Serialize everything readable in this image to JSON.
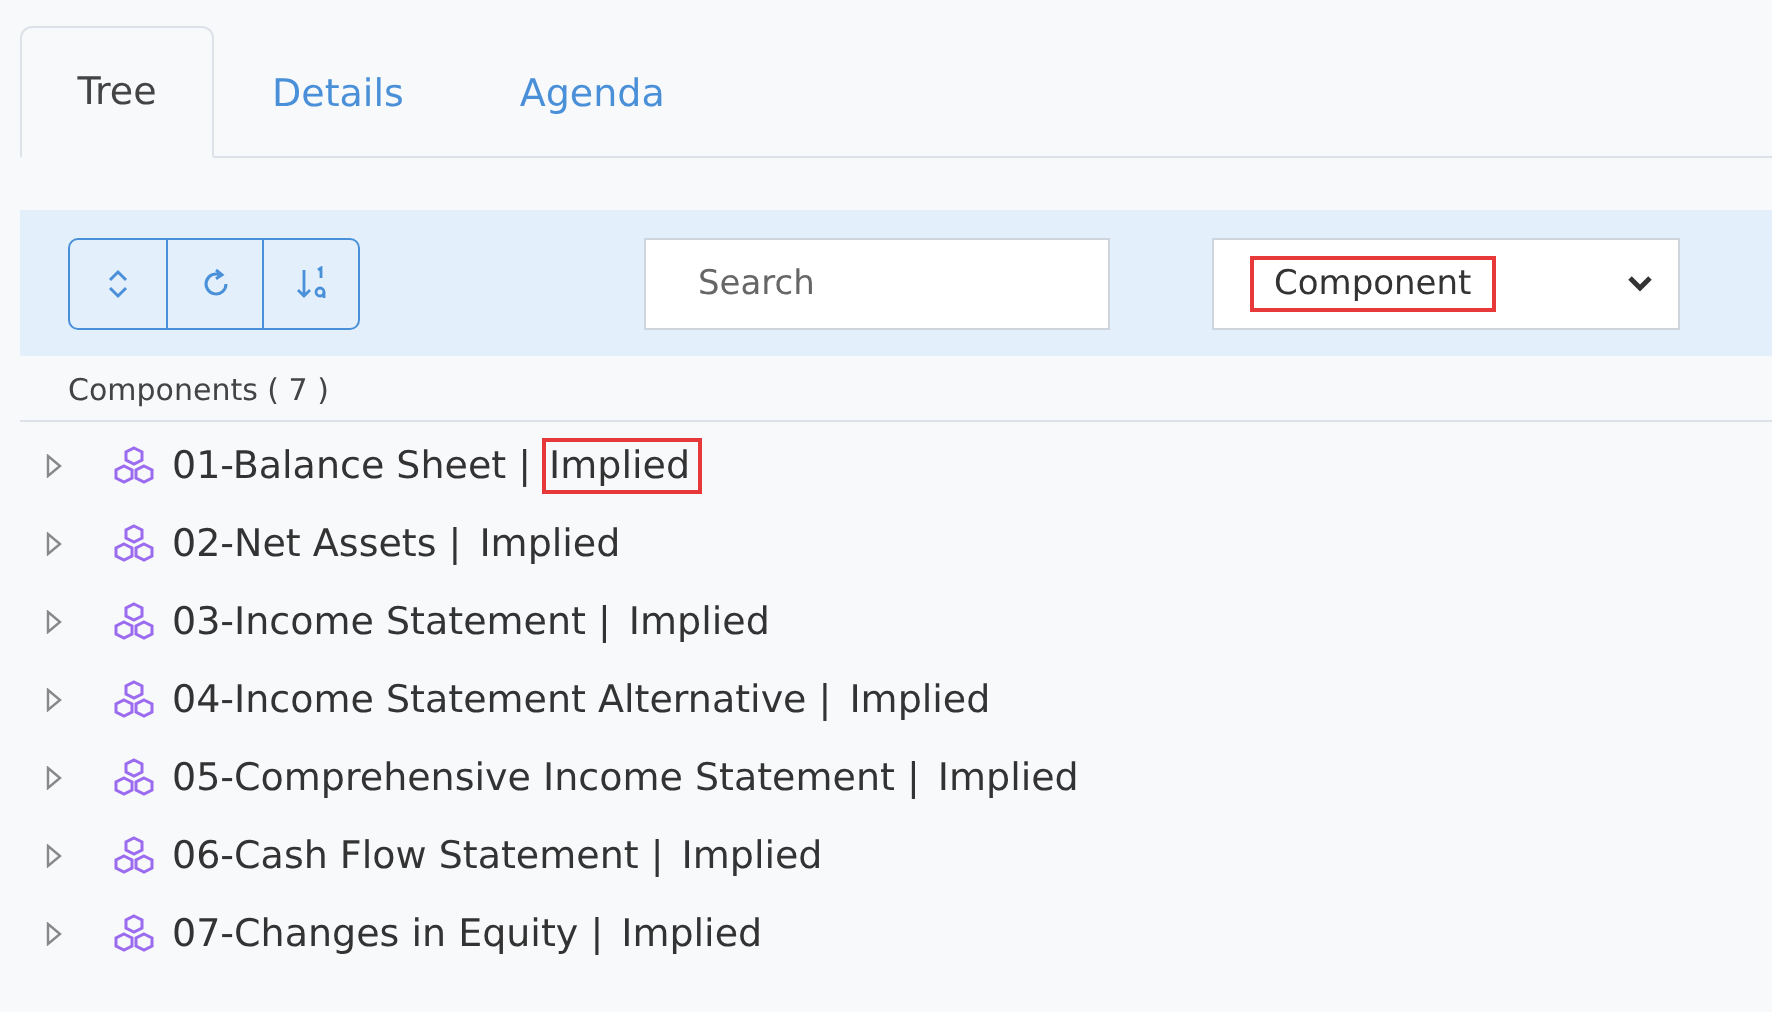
{
  "tabs": [
    {
      "label": "Tree",
      "selected": true
    },
    {
      "label": "Details",
      "selected": false
    },
    {
      "label": "Agenda",
      "selected": false
    }
  ],
  "toolbar": {
    "buttons": [
      {
        "kind": "expand"
      },
      {
        "kind": "refresh"
      },
      {
        "kind": "sort"
      }
    ],
    "search": {
      "placeholder": "Search"
    },
    "type_select": {
      "value": "Component",
      "highlighted": true
    }
  },
  "list_header": "Components ( 7 )",
  "components": [
    {
      "label": "01-Balance Sheet |",
      "status": "Implied",
      "highlighted": true,
      "expanded": false
    },
    {
      "label": "02-Net Assets |",
      "status": "Implied",
      "highlighted": false,
      "expanded": false
    },
    {
      "label": "03-Income Statement |",
      "status": "Implied",
      "highlighted": false,
      "expanded": false
    },
    {
      "label": "04-Income Statement Alternative |",
      "status": "Implied",
      "highlighted": false,
      "expanded": false
    },
    {
      "label": "05-Comprehensive Income Statement |",
      "status": "Implied",
      "highlighted": false,
      "expanded": false
    },
    {
      "label": "06-Cash Flow Statement |",
      "status": "Implied",
      "highlighted": false,
      "expanded": false
    },
    {
      "label": "07-Changes in Equity |",
      "status": "Implied",
      "highlighted": false,
      "expanded": false
    }
  ]
}
